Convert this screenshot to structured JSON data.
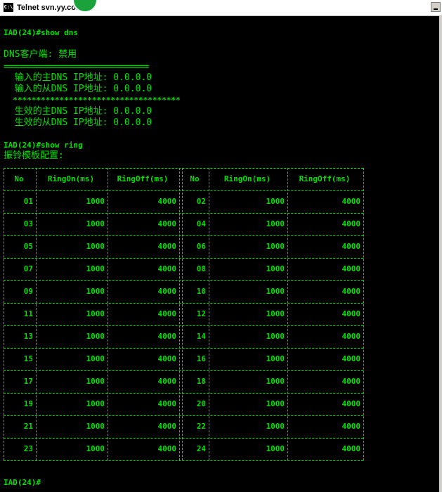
{
  "window": {
    "title": "Telnet svn.yy.com",
    "sys_icon": "C:\\"
  },
  "terminal": {
    "cmd_dns": "IAD(24)#show dns",
    "dns_client": "DNS客户端: 禁用",
    "eq_rule": "======================================",
    "in_primary": "  输入的主DNS IP地址: 0.0.0.0",
    "in_secondary": "  输入的从DNS IP地址: 0.0.0.0",
    "star_rule": "  ************************************",
    "eff_primary": "  生效的主DNS IP地址: 0.0.0.0",
    "eff_secondary": "  生效的从DNS IP地址: 0.0.0.0",
    "cmd_ring": "IAD(24)#show ring",
    "ring_title": "振铃模板配置:",
    "prompt": "IAD(24)#"
  },
  "ring_table": {
    "headers": [
      "No",
      "RingOn(ms)",
      "RingOff(ms)",
      "No",
      "RingOn(ms)",
      "RingOff(ms)"
    ],
    "rows": [
      [
        "01",
        "1000",
        "4000",
        "02",
        "1000",
        "4000"
      ],
      [
        "03",
        "1000",
        "4000",
        "04",
        "1000",
        "4000"
      ],
      [
        "05",
        "1000",
        "4000",
        "06",
        "1000",
        "4000"
      ],
      [
        "07",
        "1000",
        "4000",
        "08",
        "1000",
        "4000"
      ],
      [
        "09",
        "1000",
        "4000",
        "10",
        "1000",
        "4000"
      ],
      [
        "11",
        "1000",
        "4000",
        "12",
        "1000",
        "4000"
      ],
      [
        "13",
        "1000",
        "4000",
        "14",
        "1000",
        "4000"
      ],
      [
        "15",
        "1000",
        "4000",
        "16",
        "1000",
        "4000"
      ],
      [
        "17",
        "1000",
        "4000",
        "18",
        "1000",
        "4000"
      ],
      [
        "19",
        "1000",
        "4000",
        "20",
        "1000",
        "4000"
      ],
      [
        "21",
        "1000",
        "4000",
        "22",
        "1000",
        "4000"
      ],
      [
        "23",
        "1000",
        "4000",
        "24",
        "1000",
        "4000"
      ]
    ]
  },
  "colors": {
    "terminal_text": "#00e000",
    "terminal_bg": "#000000"
  }
}
